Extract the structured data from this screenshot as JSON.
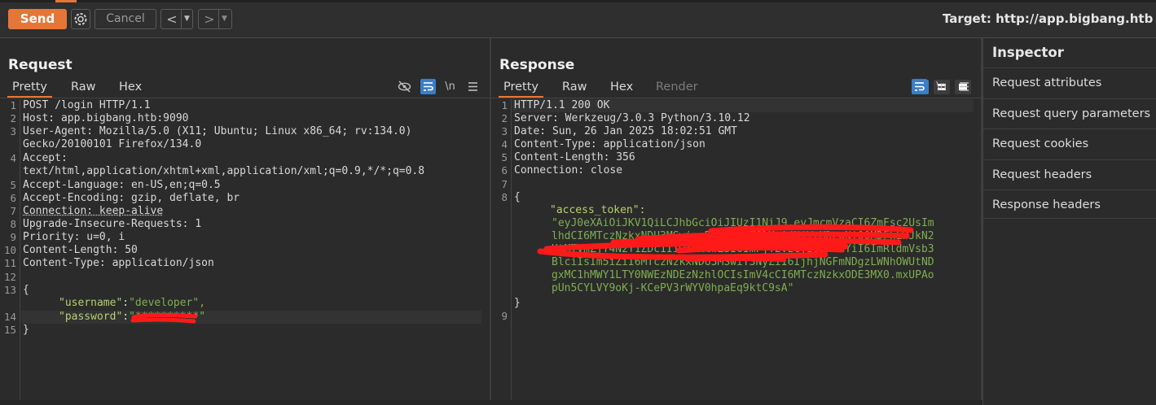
{
  "toolbar": {
    "send_label": "Send",
    "cancel_label": "Cancel",
    "back_label": "<",
    "forward_label": ">",
    "target_label": "Target: http://app.bigbang.htb"
  },
  "request": {
    "title": "Request",
    "tabs": [
      "Pretty",
      "Raw",
      "Hex"
    ],
    "active_tab": "Pretty",
    "newline_label": "\\n",
    "lines": [
      {
        "n": "1",
        "text": "POST /login HTTP/1.1"
      },
      {
        "n": "2",
        "text": "Host: app.bigbang.htb:9090"
      },
      {
        "n": "3",
        "text": "User-Agent: Mozilla/5.0 (X11; Ubuntu; Linux x86_64; rv:134.0)"
      },
      {
        "n": "",
        "text": "Gecko/20100101 Firefox/134.0"
      },
      {
        "n": "4",
        "text": "Accept:"
      },
      {
        "n": "",
        "text": "text/html,application/xhtml+xml,application/xml;q=0.9,*/*;q=0.8"
      },
      {
        "n": "5",
        "text": "Accept-Language: en-US,en;q=0.5"
      },
      {
        "n": "6",
        "text": "Accept-Encoding: gzip, deflate, br"
      },
      {
        "n": "7",
        "text": "Connection: keep-alive"
      },
      {
        "n": "8",
        "text": "Upgrade-Insecure-Requests: 1"
      },
      {
        "n": "9",
        "text": "Priority: u=0, i"
      },
      {
        "n": "10",
        "text": "Content-Length: 50"
      },
      {
        "n": "11",
        "text": "Content-Type: application/json"
      },
      {
        "n": "12",
        "text": ""
      },
      {
        "n": "13",
        "text": "{"
      },
      {
        "n": "",
        "text": ""
      },
      {
        "n": "14",
        "text": ""
      },
      {
        "n": "15",
        "text": "}"
      }
    ],
    "body": {
      "username_key": "\"username\"",
      "username_value": "\"developer\",",
      "password_key": "\"password\"",
      "password_value": "\"**********\""
    }
  },
  "response": {
    "title": "Response",
    "tabs": [
      "Pretty",
      "Raw",
      "Hex",
      "Render"
    ],
    "active_tab": "Pretty",
    "newline_label": "\\n",
    "lines": [
      {
        "n": "1",
        "text": "HTTP/1.1 200 OK"
      },
      {
        "n": "2",
        "text": "Server: Werkzeug/3.0.3 Python/3.10.12"
      },
      {
        "n": "3",
        "text": "Date: Sun, 26 Jan 2025 18:02:51 GMT"
      },
      {
        "n": "4",
        "text": "Content-Type: application/json"
      },
      {
        "n": "5",
        "text": "Content-Length: 356"
      },
      {
        "n": "6",
        "text": "Connection: close"
      },
      {
        "n": "7",
        "text": ""
      },
      {
        "n": "8",
        "text": "{"
      }
    ],
    "token_key": "\"access_token\":",
    "token_lines": [
      "\"eyJ0eXAiOiJKV1QiLCJhbGciOiJIUzI1NiJ9.eyJmcmVzaCI6ZmFsc2UsIm",
      "lhdCI6MTczNzkxNDU3MSwianRpIjoiYTJlMzA4NjYtMDcwNi00MDFhLWJkN2",
      "UtMTVmZjY4N2Y1ZDc1IiwidHlwZSI6ImFjY2VzcyIsInN1YiI6ImRldmVsb3",
      "BlciIsIm5iZiI6MTczNzkxNDU3MSwiY3NyZiI6IjhjNGFmNDgzLWNhOWUtND",
      "gxMC1hMWY1LTY0NWEzNDEzNzhlOCIsImV4cCI6MTczNzkxODE3MX0.mxUPAo",
      "pUn5CYLVY9oKj-KCePV3rWYV0hpaEq9ktC9sA\""
    ],
    "close_brace": "}",
    "close_n": "9"
  },
  "inspector": {
    "title": "Inspector",
    "items": [
      "Request attributes",
      "Request query parameters",
      "Request cookies",
      "Request headers",
      "Response headers"
    ]
  },
  "colors": {
    "accent": "#e5763a",
    "active_blue": "#3b7dc6",
    "json_green": "#7fae4f",
    "redaction_red": "#ff1a1a"
  },
  "icons": [
    "settings-gear-icon",
    "eye-slash-icon",
    "wrap-lines-icon",
    "hamburger-menu-icon"
  ]
}
